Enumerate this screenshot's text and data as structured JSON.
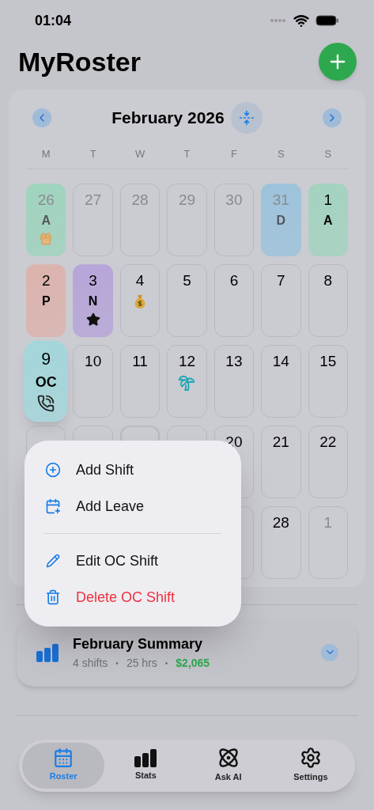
{
  "status_bar": {
    "time": "01:04"
  },
  "title": "MyRoster",
  "calendar": {
    "month": "February 2026",
    "weekdays": [
      "M",
      "T",
      "W",
      "T",
      "F",
      "S",
      "S"
    ],
    "weeks": [
      [
        {
          "day": "26",
          "muted": true,
          "today": false,
          "shift": "A",
          "color": "#9fd4bd",
          "kind": "gift"
        },
        {
          "day": "27",
          "muted": true,
          "today": false
        },
        {
          "day": "28",
          "muted": true,
          "today": false
        },
        {
          "day": "29",
          "muted": true,
          "today": false
        },
        {
          "day": "30",
          "muted": true,
          "today": false
        },
        {
          "day": "31",
          "muted": true,
          "today": false,
          "shift": "D",
          "color": "#9cc3dc"
        },
        {
          "day": "1",
          "muted": false,
          "today": false,
          "shift": "A",
          "color": "#a3d3bf"
        }
      ],
      [
        {
          "day": "2",
          "muted": false,
          "today": false,
          "shift": "P",
          "color": "#dcb3ad"
        },
        {
          "day": "3",
          "muted": false,
          "today": false,
          "shift": "N",
          "color": "#b6a5d8",
          "kind": "star"
        },
        {
          "day": "4",
          "muted": false,
          "today": false,
          "kind": "money"
        },
        {
          "day": "5",
          "muted": false,
          "today": false
        },
        {
          "day": "6",
          "muted": false,
          "today": false
        },
        {
          "day": "7",
          "muted": false,
          "today": false
        },
        {
          "day": "8",
          "muted": false,
          "today": false
        }
      ],
      [
        {
          "day": "9",
          "muted": false,
          "today": false,
          "shift": "OC",
          "color": "#a3d6da",
          "kind": "phone",
          "pressed": true
        },
        {
          "day": "10",
          "muted": false,
          "today": false
        },
        {
          "day": "11",
          "muted": false,
          "today": false
        },
        {
          "day": "12",
          "muted": false,
          "today": false,
          "kind": "palm"
        },
        {
          "day": "13",
          "muted": false,
          "today": false
        },
        {
          "day": "14",
          "muted": false,
          "today": false
        },
        {
          "day": "15",
          "muted": false,
          "today": false
        }
      ],
      [
        {
          "today": false
        },
        {
          "today": false
        },
        {
          "today": true
        },
        {
          "today": false
        },
        {
          "day": "20",
          "muted": false,
          "today": false
        },
        {
          "day": "21",
          "muted": false,
          "today": false
        },
        {
          "day": "22",
          "muted": false,
          "today": false
        }
      ],
      [
        {
          "today": false
        },
        {
          "day": "28",
          "muted": false,
          "today": false
        },
        {
          "day": "1",
          "muted": true,
          "today": false
        }
      ]
    ]
  },
  "context_menu": [
    [
      {
        "label": "Add Shift",
        "kind": "plus",
        "destructive": false
      },
      {
        "label": "Add Leave",
        "kind": "calendar",
        "destructive": false
      }
    ],
    [
      {
        "label": "Edit OC Shift",
        "kind": "pencil",
        "destructive": false
      },
      {
        "label": "Delete OC Shift",
        "kind": "trash",
        "destructive": true
      }
    ]
  ],
  "summary": {
    "title": "February Summary",
    "shifts": "4 shifts",
    "hours": "25 hrs",
    "pay": "$2,065",
    "separator": "•"
  },
  "tabs": [
    {
      "label": "Roster",
      "kind": "calendar",
      "selected": true
    },
    {
      "label": "Stats",
      "kind": "stats",
      "selected": false
    },
    {
      "label": "Ask AI",
      "kind": "ai",
      "selected": false
    },
    {
      "label": "Settings",
      "kind": "gear",
      "selected": false
    }
  ]
}
